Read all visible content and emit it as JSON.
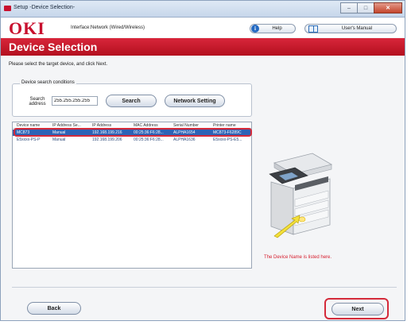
{
  "window": {
    "title": "Setup -Device Selection-",
    "buttons": {
      "minimize": "–",
      "maximize": "□",
      "close": "✕"
    }
  },
  "header": {
    "logo": "OKI",
    "interface": "Interface:Network (Wired/Wireless)",
    "help_label": "Help",
    "manual_label": "User's Manual"
  },
  "banner": {
    "title": "Device Selection"
  },
  "instruction": "Please select the target device, and click Next.",
  "search": {
    "group_label": "Device search conditions",
    "address_label": "Search address",
    "address_value": "255.255.255.255",
    "search_button": "Search",
    "network_button": "Network Setting"
  },
  "device_table": {
    "columns": [
      "Device name",
      "IP Address Se...",
      "IP Address",
      "MAC Address",
      "Serial Number",
      "Printer name"
    ],
    "rows": [
      [
        "MC873",
        "Manual",
        "192.168.199.216",
        "00:25:36:F6:28...",
        "ALPHA1654",
        "MC873-F6289C"
      ],
      [
        "E5xxxx-PS-P",
        "Manual",
        "192.168.199.206",
        "00:25:36:F6:28...",
        "ALPHA1636",
        "E5xxxx-PS-E5..."
      ]
    ],
    "selected_index": 0
  },
  "illustration": {
    "caption": "The Device Name is listed here."
  },
  "footer": {
    "back_button": "Back",
    "next_button": "Next"
  },
  "colors": {
    "brand_red": "#c8102e",
    "selection_blue": "#2d63b6",
    "highlight_red": "#d42a3a"
  }
}
